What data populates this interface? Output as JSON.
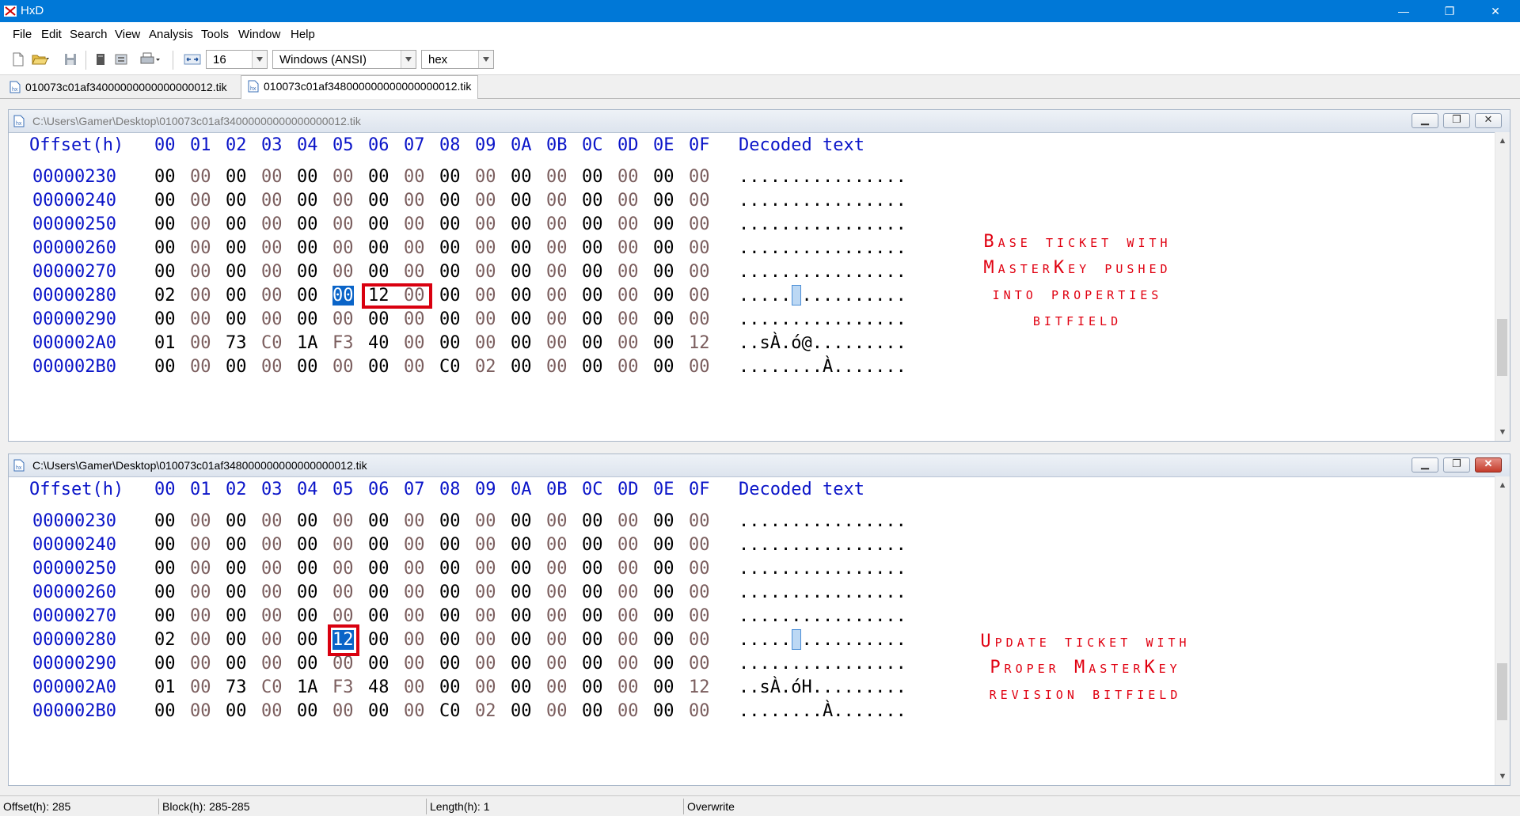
{
  "window": {
    "title": "HxD",
    "minimize": "—",
    "maximize": "❐",
    "close": "✕"
  },
  "menu": [
    "File",
    "Edit",
    "Search",
    "View",
    "Analysis",
    "Tools",
    "Window",
    "Help"
  ],
  "toolbar": {
    "icons": [
      "new-file-icon",
      "open-file-icon",
      "save-icon",
      "close-file-icon",
      "properties-icon",
      "print-icon"
    ],
    "bytes_per_row": "16",
    "charset": "Windows (ANSI)",
    "offset_base": "hex"
  },
  "tabs": [
    {
      "label": "010073c01af34000000000000000012.tik"
    },
    {
      "label": "010073c01af348000000000000000012.tik"
    }
  ],
  "header": {
    "offset_label": "Offset(h)",
    "columns": [
      "00",
      "01",
      "02",
      "03",
      "04",
      "05",
      "06",
      "07",
      "08",
      "09",
      "0A",
      "0B",
      "0C",
      "0D",
      "0E",
      "0F"
    ],
    "decoded_label": "Decoded text"
  },
  "editors": [
    {
      "path": "C:\\Users\\Gamer\\Desktop\\010073c01af34000000000000000012.tik",
      "rows": [
        {
          "offset": "00000230",
          "bytes": [
            "00",
            "00",
            "00",
            "00",
            "00",
            "00",
            "00",
            "00",
            "00",
            "00",
            "00",
            "00",
            "00",
            "00",
            "00",
            "00"
          ],
          "text": "................"
        },
        {
          "offset": "00000240",
          "bytes": [
            "00",
            "00",
            "00",
            "00",
            "00",
            "00",
            "00",
            "00",
            "00",
            "00",
            "00",
            "00",
            "00",
            "00",
            "00",
            "00"
          ],
          "text": "................"
        },
        {
          "offset": "00000250",
          "bytes": [
            "00",
            "00",
            "00",
            "00",
            "00",
            "00",
            "00",
            "00",
            "00",
            "00",
            "00",
            "00",
            "00",
            "00",
            "00",
            "00"
          ],
          "text": "................"
        },
        {
          "offset": "00000260",
          "bytes": [
            "00",
            "00",
            "00",
            "00",
            "00",
            "00",
            "00",
            "00",
            "00",
            "00",
            "00",
            "00",
            "00",
            "00",
            "00",
            "00"
          ],
          "text": "................"
        },
        {
          "offset": "00000270",
          "bytes": [
            "00",
            "00",
            "00",
            "00",
            "00",
            "00",
            "00",
            "00",
            "00",
            "00",
            "00",
            "00",
            "00",
            "00",
            "00",
            "00"
          ],
          "text": "................"
        },
        {
          "offset": "00000280",
          "bytes": [
            "02",
            "00",
            "00",
            "00",
            "00",
            "00",
            "12",
            "00",
            "00",
            "00",
            "00",
            "00",
            "00",
            "00",
            "00",
            "00"
          ],
          "text": "................"
        },
        {
          "offset": "00000290",
          "bytes": [
            "00",
            "00",
            "00",
            "00",
            "00",
            "00",
            "00",
            "00",
            "00",
            "00",
            "00",
            "00",
            "00",
            "00",
            "00",
            "00"
          ],
          "text": "................"
        },
        {
          "offset": "000002A0",
          "bytes": [
            "01",
            "00",
            "73",
            "C0",
            "1A",
            "F3",
            "40",
            "00",
            "00",
            "00",
            "00",
            "00",
            "00",
            "00",
            "00",
            "12"
          ],
          "text": "..sÀ.ó@........."
        },
        {
          "offset": "000002B0",
          "bytes": [
            "00",
            "00",
            "00",
            "00",
            "00",
            "00",
            "00",
            "00",
            "C0",
            "02",
            "00",
            "00",
            "00",
            "00",
            "00",
            "00"
          ],
          "text": "........À......."
        }
      ],
      "annotation": [
        "Base ticket with",
        "MasterKey pushed",
        "into properties",
        "bitfield"
      ]
    },
    {
      "path": "C:\\Users\\Gamer\\Desktop\\010073c01af348000000000000000012.tik",
      "rows": [
        {
          "offset": "00000230",
          "bytes": [
            "00",
            "00",
            "00",
            "00",
            "00",
            "00",
            "00",
            "00",
            "00",
            "00",
            "00",
            "00",
            "00",
            "00",
            "00",
            "00"
          ],
          "text": "................"
        },
        {
          "offset": "00000240",
          "bytes": [
            "00",
            "00",
            "00",
            "00",
            "00",
            "00",
            "00",
            "00",
            "00",
            "00",
            "00",
            "00",
            "00",
            "00",
            "00",
            "00"
          ],
          "text": "................"
        },
        {
          "offset": "00000250",
          "bytes": [
            "00",
            "00",
            "00",
            "00",
            "00",
            "00",
            "00",
            "00",
            "00",
            "00",
            "00",
            "00",
            "00",
            "00",
            "00",
            "00"
          ],
          "text": "................"
        },
        {
          "offset": "00000260",
          "bytes": [
            "00",
            "00",
            "00",
            "00",
            "00",
            "00",
            "00",
            "00",
            "00",
            "00",
            "00",
            "00",
            "00",
            "00",
            "00",
            "00"
          ],
          "text": "................"
        },
        {
          "offset": "00000270",
          "bytes": [
            "00",
            "00",
            "00",
            "00",
            "00",
            "00",
            "00",
            "00",
            "00",
            "00",
            "00",
            "00",
            "00",
            "00",
            "00",
            "00"
          ],
          "text": "................"
        },
        {
          "offset": "00000280",
          "bytes": [
            "02",
            "00",
            "00",
            "00",
            "00",
            "12",
            "00",
            "00",
            "00",
            "00",
            "00",
            "00",
            "00",
            "00",
            "00",
            "00"
          ],
          "text": "................"
        },
        {
          "offset": "00000290",
          "bytes": [
            "00",
            "00",
            "00",
            "00",
            "00",
            "00",
            "00",
            "00",
            "00",
            "00",
            "00",
            "00",
            "00",
            "00",
            "00",
            "00"
          ],
          "text": "................"
        },
        {
          "offset": "000002A0",
          "bytes": [
            "01",
            "00",
            "73",
            "C0",
            "1A",
            "F3",
            "48",
            "00",
            "00",
            "00",
            "00",
            "00",
            "00",
            "00",
            "00",
            "12"
          ],
          "text": "..sÀ.óH........."
        },
        {
          "offset": "000002B0",
          "bytes": [
            "00",
            "00",
            "00",
            "00",
            "00",
            "00",
            "00",
            "00",
            "C0",
            "02",
            "00",
            "00",
            "00",
            "00",
            "00",
            "00"
          ],
          "text": "........À......."
        }
      ],
      "annotation": [
        "Update ticket with",
        "Proper MasterKey",
        "revision bitfield"
      ]
    }
  ],
  "status": {
    "offset": "Offset(h): 285",
    "block": "Block(h): 285-285",
    "length": "Length(h): 1",
    "mode": "Overwrite"
  },
  "colors": {
    "accent": "#0078d7",
    "hex_blue": "#0a14c8",
    "highlight_red": "#d9000f",
    "selection": "#0a64c8"
  }
}
